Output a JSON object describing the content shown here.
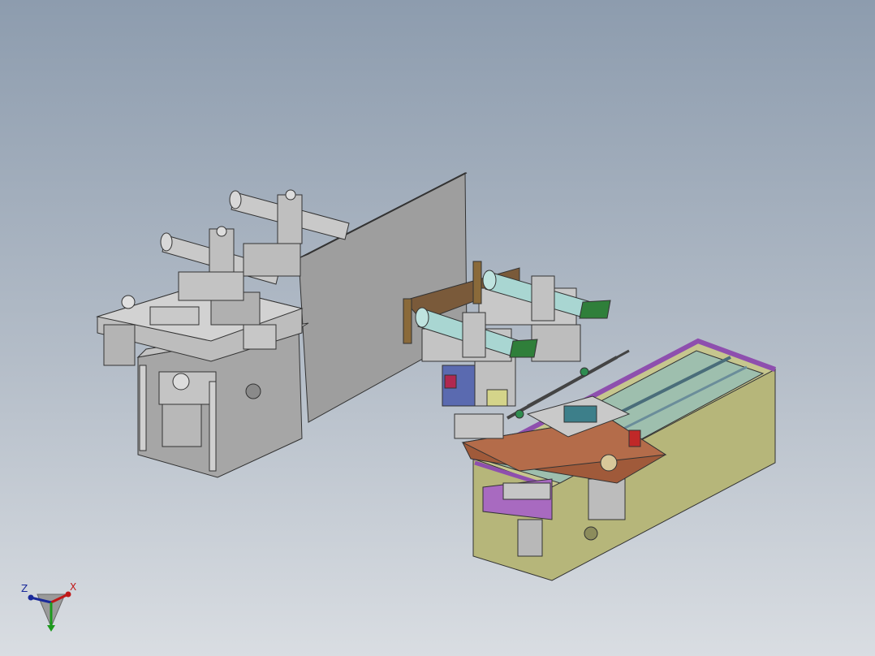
{
  "viewport": {
    "background_top": "#8d9cae",
    "background_bottom": "#d9dde2"
  },
  "triad": {
    "z_label": "Z",
    "x_label": "X",
    "colors": {
      "x": "#c01818",
      "y": "#1c9a1c",
      "z": "#1a2a9a"
    }
  },
  "model_colors": {
    "steel": "#b9b9b9",
    "plate": "#9d9d9d",
    "cylinder_cyan": "#a9d6d2",
    "valve_green": "#2f7f3a",
    "frame_purple": "#8e4fae",
    "frame_olive": "#b6b67a",
    "bracket_brown": "#9a5a3a",
    "block_blue": "#5a6ab0",
    "block_red": "#c02828"
  }
}
